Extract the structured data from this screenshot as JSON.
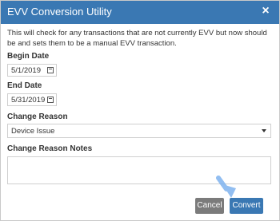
{
  "dialog": {
    "title": "EVV Conversion Utility",
    "close_glyph": "×",
    "description": "This will check for any transactions that are not currently EVV but now should be and sets them to be a manual EVV transaction.",
    "begin_date": {
      "label": "Begin Date",
      "value": "5/1/2019"
    },
    "end_date": {
      "label": "End Date",
      "value": "5/31/2019"
    },
    "change_reason": {
      "label": "Change Reason",
      "selected": "Device Issue"
    },
    "change_reason_notes": {
      "label": "Change Reason Notes",
      "value": ""
    },
    "buttons": {
      "cancel": "Cancel",
      "convert": "Convert"
    }
  },
  "colors": {
    "titlebar": "#3a78b3",
    "primary_button": "#3a78b3",
    "secondary_button": "#7b7b7b"
  },
  "icons": {
    "close": "close-icon",
    "calendar": "calendar-icon",
    "dropdown": "chevron-down-icon",
    "cursor": "cursor-arrow-icon"
  }
}
